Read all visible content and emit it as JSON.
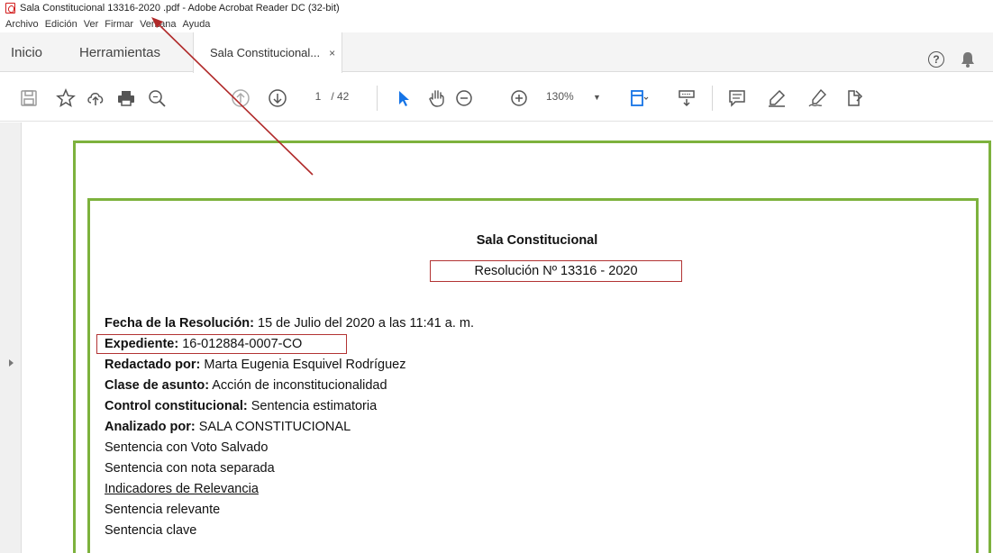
{
  "window": {
    "title": "Sala Constitucional 13316-2020 .pdf - Adobe Acrobat Reader DC (32-bit)"
  },
  "menu": [
    "Archivo",
    "Edición",
    "Ver",
    "Firmar",
    "Ventana",
    "Ayuda"
  ],
  "tabs": {
    "home": "Inicio",
    "tools": "Herramientas",
    "document": "Sala Constitucional...",
    "close": "×"
  },
  "toolbar": {
    "page_current": "1",
    "page_total": "/ 42",
    "zoom": "130%",
    "zoom_caret": "▼",
    "icons": [
      "save-icon",
      "bookmark-star-icon",
      "cloud-upload-icon",
      "print-icon",
      "search-zoom-icon",
      "page-up-icon",
      "page-down-icon",
      "select-cursor-icon",
      "hand-tool-icon",
      "zoom-out-icon",
      "zoom-in-icon",
      "fit-page-icon",
      "scroll-mode-icon",
      "comment-icon",
      "highlight-icon",
      "sign-icon",
      "more-tools-icon"
    ]
  },
  "header_icons": [
    "help-icon",
    "notifications-bell-icon"
  ],
  "document": {
    "heading": "Sala Constitucional",
    "resolution": "Resolución Nº 13316 - 2020",
    "fields": [
      {
        "label": "Fecha de la Resolución:",
        "value": " 15 de Julio del 2020 a las 11:41 a. m."
      },
      {
        "label": "Expediente:",
        "value": " 16-012884-0007-CO"
      },
      {
        "label": "Redactado por:",
        "value": " Marta Eugenia Esquivel Rodríguez"
      },
      {
        "label": "Clase de asunto:",
        "value": " Acción de inconstitucionalidad"
      },
      {
        "label": "Control constitucional:",
        "value": " Sentencia estimatoria"
      },
      {
        "label": "Analizado por:",
        "value": " SALA CONSTITUCIONAL"
      }
    ],
    "lines": [
      "Sentencia con Voto Salvado",
      "Sentencia con nota separada",
      "Indicadores de Relevancia",
      "Sentencia relevante",
      "Sentencia clave"
    ]
  },
  "colors": {
    "frame_green": "#7db23d",
    "highlight_red": "#b23333",
    "arrow_red": "#b02a2a",
    "acrobat_red": "#d21d1d"
  }
}
